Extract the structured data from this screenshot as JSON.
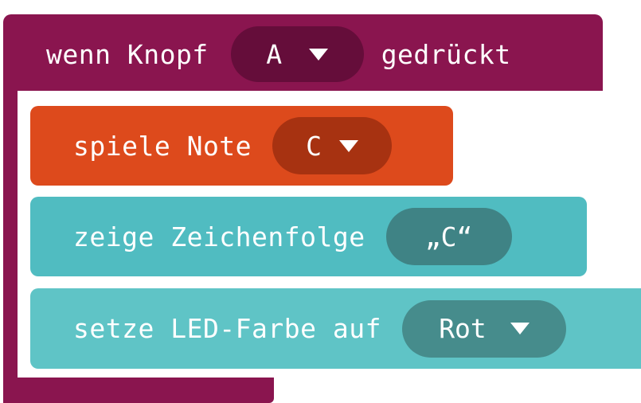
{
  "colors": {
    "event_block": "#8a154f",
    "event_pill": "#650d3a",
    "music_block": "#dd4a1c",
    "music_pill": "#a73211",
    "display_block": "#50bcc1",
    "display_pill": "#3f8385",
    "led_block": "#5fc4c6",
    "led_pill": "#468c8c"
  },
  "event": {
    "prefix": "wenn Knopf",
    "button_value": "A",
    "suffix": "gedrückt",
    "dropdown_icon": "triangle-down-icon"
  },
  "blocks": {
    "play_note": {
      "label": "spiele Note",
      "note_value": "C",
      "dropdown_icon": "triangle-down-icon"
    },
    "show_string": {
      "label": "zeige Zeichenfolge",
      "string_value": "„C“"
    },
    "set_led": {
      "label": "setze LED-Farbe auf",
      "color_value": "Rot",
      "dropdown_icon": "triangle-down-icon"
    }
  }
}
